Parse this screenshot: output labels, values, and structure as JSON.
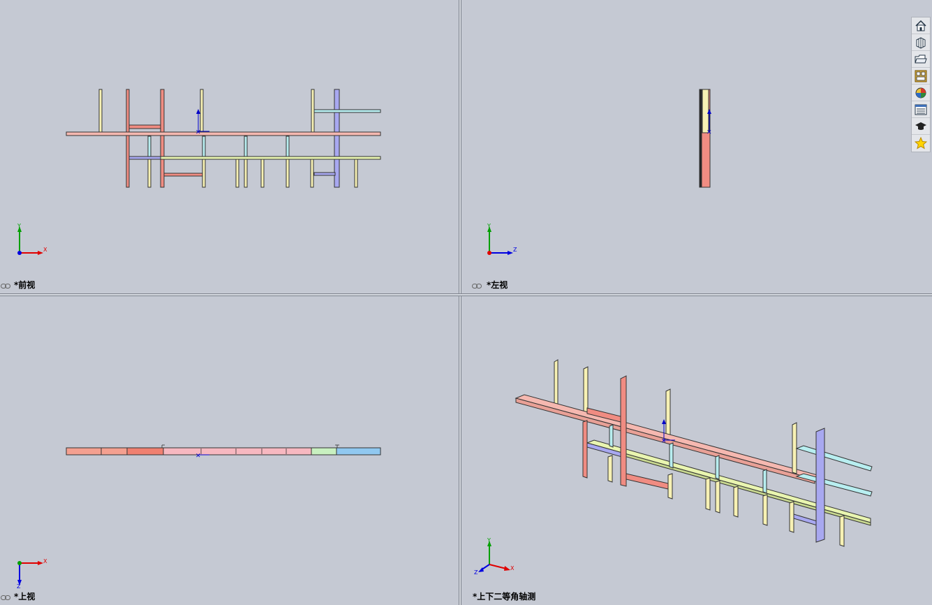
{
  "colors": {
    "background": "#c5c9d3",
    "member_red": "#f08c82",
    "member_yellow": "#f7f1b4",
    "member_blue": "#a8a8f0",
    "member_cyan": "#b8eef0",
    "member_green": "#c8f0c0",
    "member_sky": "#90c8f0",
    "origin_blue": "#0000c8",
    "axis_x": "#e00000",
    "axis_y": "#00a000",
    "axis_z": "#0000e0"
  },
  "heads_up_toolbar": {
    "buttons": [
      {
        "icon": "zoom-to-fit-icon",
        "has_dropdown": false
      },
      {
        "icon": "zoom-to-area-icon",
        "has_dropdown": false
      },
      {
        "icon": "previous-view-icon",
        "has_dropdown": false
      },
      {
        "icon": "section-view-icon",
        "has_dropdown": false
      },
      {
        "icon": "view-orientation-icon",
        "has_dropdown": true
      },
      {
        "icon": "display-style-icon",
        "has_dropdown": true
      },
      {
        "icon": "hide-show-items-icon",
        "has_dropdown": true
      },
      {
        "icon": "edit-appearance-icon",
        "has_dropdown": false
      },
      {
        "icon": "apply-scene-icon",
        "has_dropdown": true
      },
      {
        "icon": "view-settings-icon",
        "has_dropdown": true
      }
    ]
  },
  "task_pane": {
    "tabs": [
      {
        "icon": "home-icon"
      },
      {
        "icon": "design-library-icon"
      },
      {
        "icon": "file-explorer-icon"
      },
      {
        "icon": "view-palette-icon"
      },
      {
        "icon": "appearances-icon"
      },
      {
        "icon": "custom-properties-icon"
      },
      {
        "icon": "tutorials-icon"
      },
      {
        "icon": "favorites-icon"
      }
    ]
  },
  "viewports": {
    "front": {
      "label": "*前视",
      "linked": true,
      "triad": {
        "a": "Y",
        "b": "X"
      }
    },
    "left": {
      "label": "*左视",
      "linked": true,
      "triad": {
        "a": "Y",
        "b": "Z"
      }
    },
    "top": {
      "label": "*上视",
      "linked": true,
      "triad": {
        "a": "X",
        "b": "Z"
      }
    },
    "iso": {
      "label": "*上下二等角轴测",
      "linked": false,
      "triad": {
        "a": "Y",
        "b": "X",
        "c": "Z"
      }
    }
  }
}
